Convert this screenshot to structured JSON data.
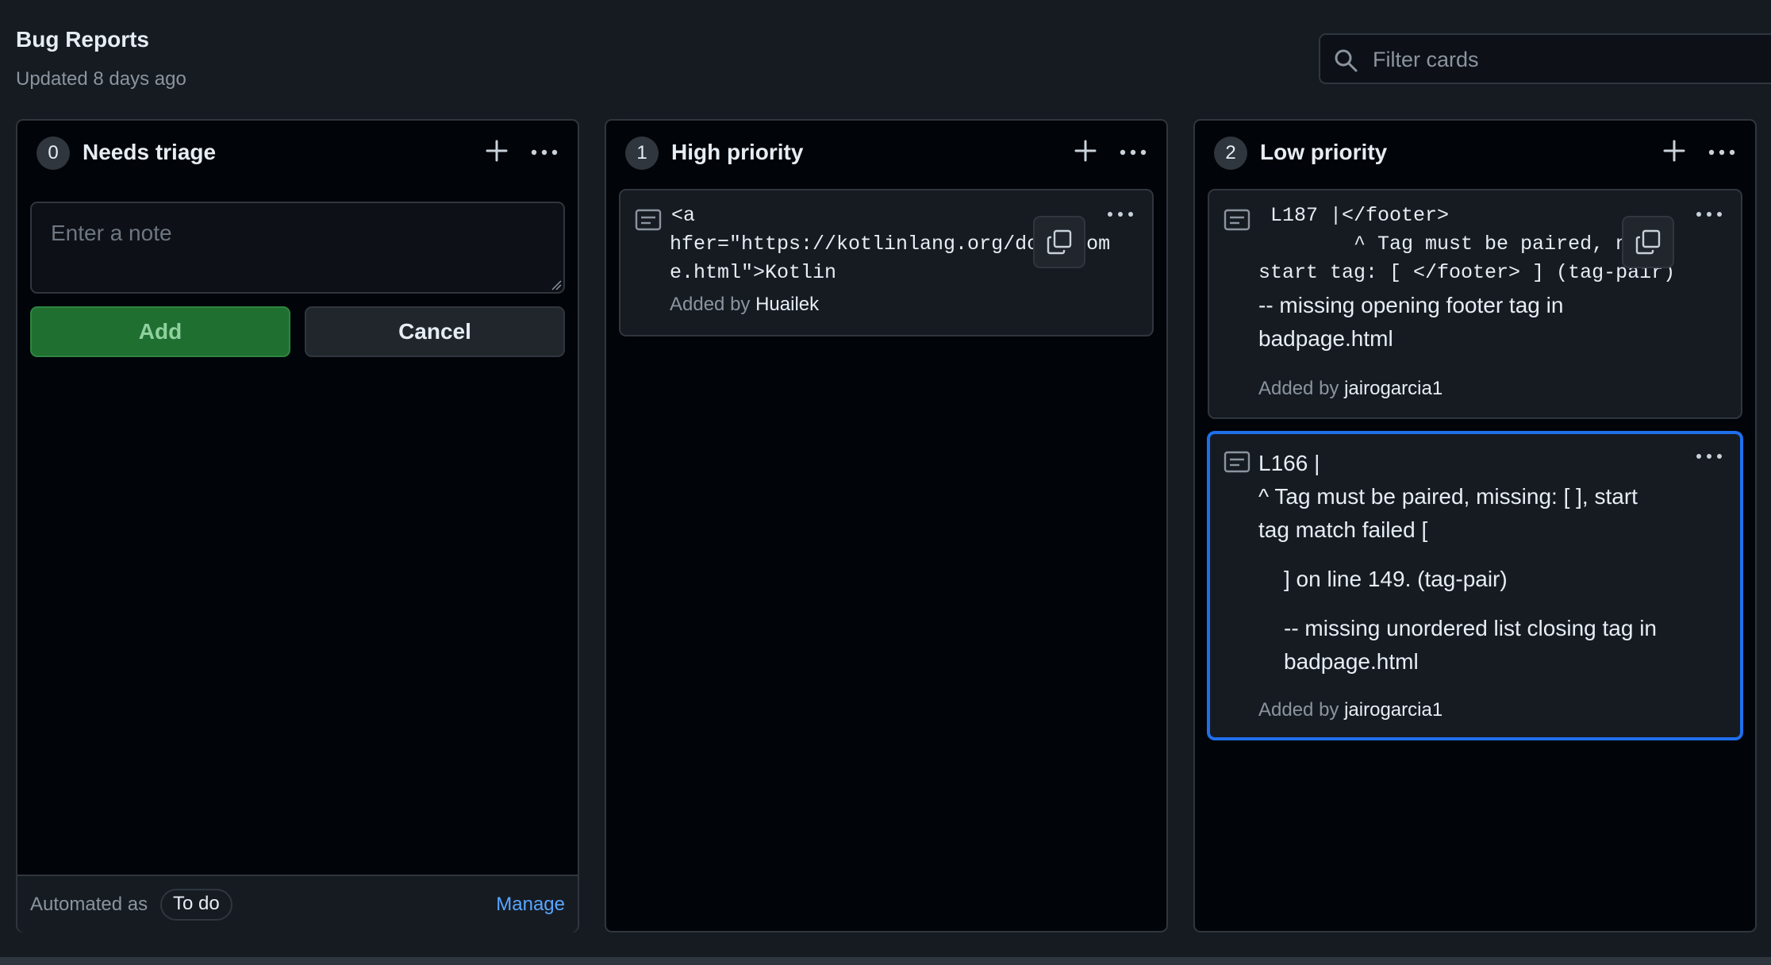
{
  "project": {
    "title": "Bug Reports",
    "updated": "Updated 8 days ago"
  },
  "filter": {
    "placeholder": "Filter cards"
  },
  "columns": [
    {
      "count": "0",
      "title": "Needs triage",
      "note_placeholder": "Enter a note",
      "add_label": "Add",
      "cancel_label": "Cancel",
      "automated_label": "Automated as",
      "automated_value": "To do",
      "manage_label": "Manage"
    },
    {
      "count": "1",
      "title": "High priority",
      "cards": [
        {
          "lines": [
            "<a",
            "hfer=\"https://kotlinlang.org/docs/hom",
            "e.html\">Kotlin"
          ],
          "added_by_label": "Added by",
          "user": "Huailek"
        }
      ]
    },
    {
      "count": "2",
      "title": "Low priority",
      "cards": [
        {
          "code_lines": [
            " L187 |</footer>",
            "        ^ Tag must be paired, no",
            "start tag: [ </footer> ] (tag-pair)"
          ],
          "text_lines": [
            "-- missing opening footer tag in",
            "badpage.html"
          ],
          "added_by_label": "Added by",
          "user": "jairogarcia1"
        },
        {
          "lines": [
            "L166 |",
            "^ Tag must be paired, missing: [ ], start",
            "tag match failed [",
            "] on line 149. (tag-pair)",
            "-- missing unordered list closing tag in",
            "badpage.html"
          ],
          "added_by_label": "Added by",
          "user": "jairogarcia1"
        }
      ]
    }
  ],
  "colors": {
    "background": "#161b22",
    "column": "#010409",
    "card": "#161b22",
    "border": "#30363d",
    "accent_blue": "#1f6feb",
    "link": "#58a6ff",
    "add_button": "#1f6f31"
  },
  "icons": [
    "search-icon",
    "plus-icon",
    "more-icon",
    "note-icon",
    "copy-icon"
  ]
}
